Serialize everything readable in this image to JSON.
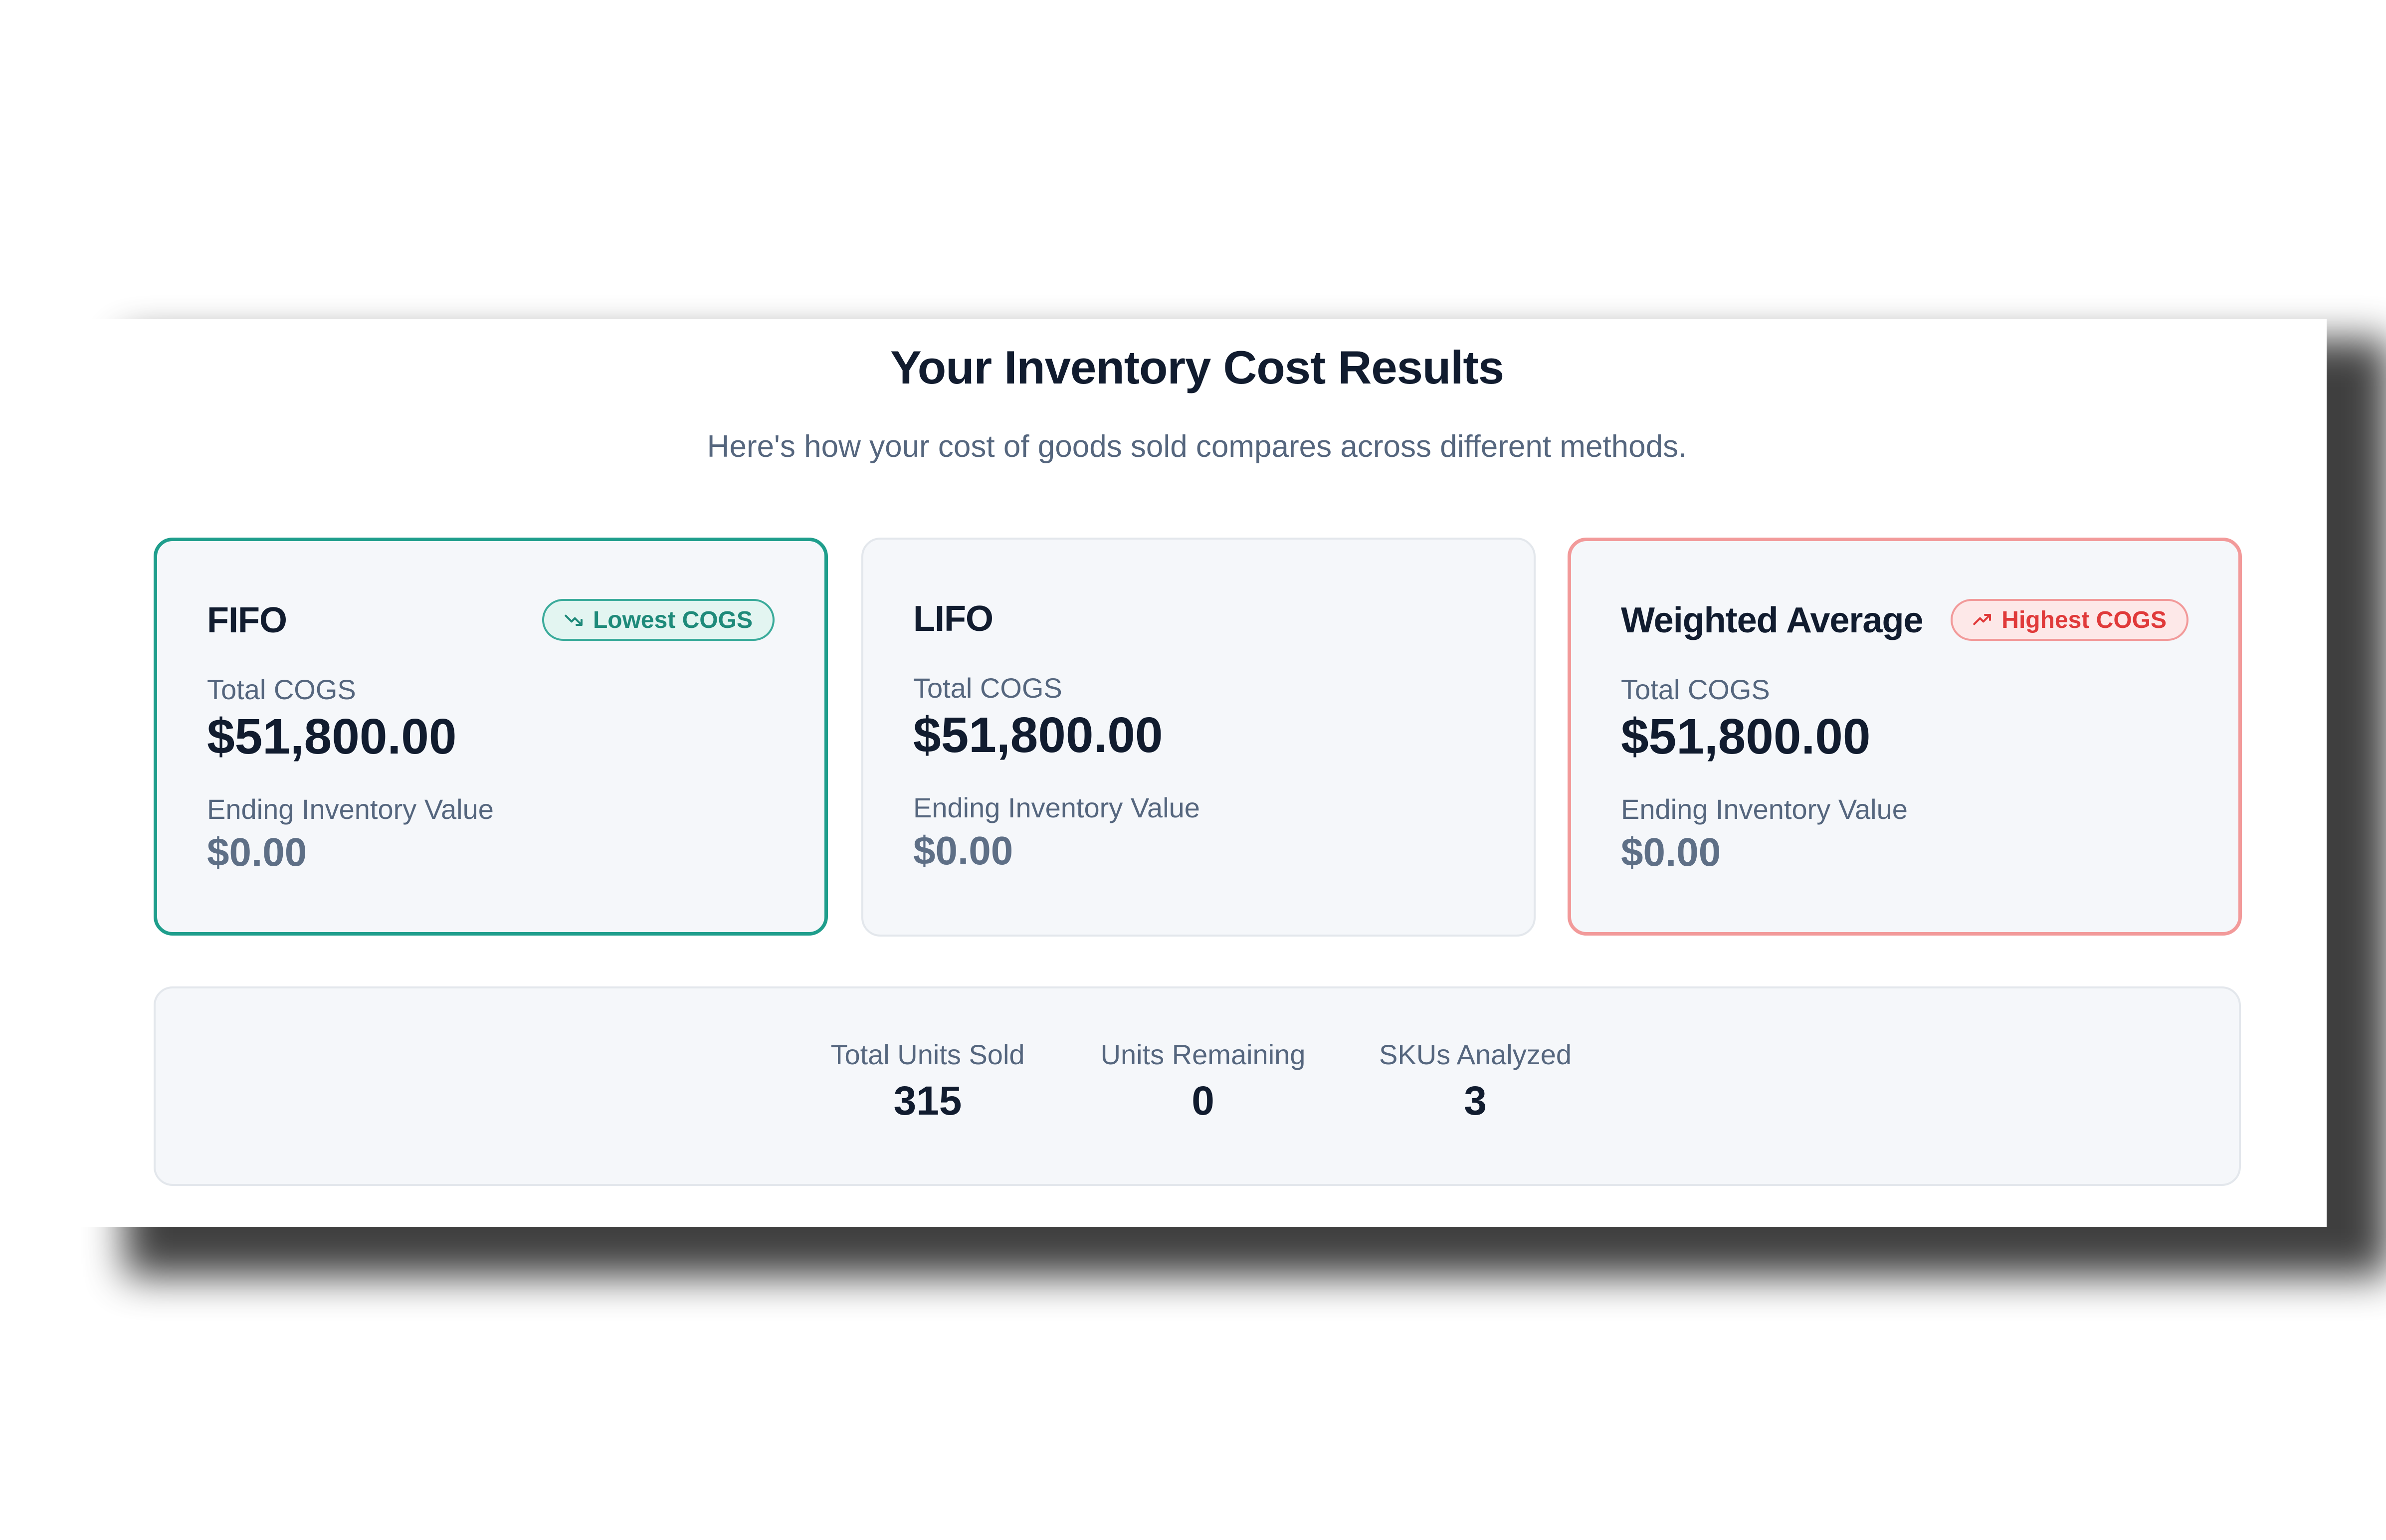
{
  "header": {
    "title": "Your Inventory Cost Results",
    "subtitle": "Here's how your cost of goods sold compares across different methods."
  },
  "cards": [
    {
      "name": "FIFO",
      "badge": "Lowest COGS",
      "badge_icon": "trending-down-icon",
      "accent_color": "#1f9e8c",
      "total_cogs_label": "Total COGS",
      "total_cogs": "$51,800.00",
      "ending_label": "Ending Inventory Value",
      "ending_value": "$0.00"
    },
    {
      "name": "LIFO",
      "total_cogs_label": "Total COGS",
      "total_cogs": "$51,800.00",
      "ending_label": "Ending Inventory Value",
      "ending_value": "$0.00"
    },
    {
      "name": "Weighted Average",
      "badge": "Highest COGS",
      "badge_icon": "trending-up-icon",
      "accent_color": "#f29a9a",
      "total_cogs_label": "Total COGS",
      "total_cogs": "$51,800.00",
      "ending_label": "Ending Inventory Value",
      "ending_value": "$0.00"
    }
  ],
  "summary": {
    "stats": [
      {
        "label": "Total Units Sold",
        "value": "315"
      },
      {
        "label": "Units Remaining",
        "value": "0"
      },
      {
        "label": "SKUs Analyzed",
        "value": "3"
      }
    ]
  }
}
